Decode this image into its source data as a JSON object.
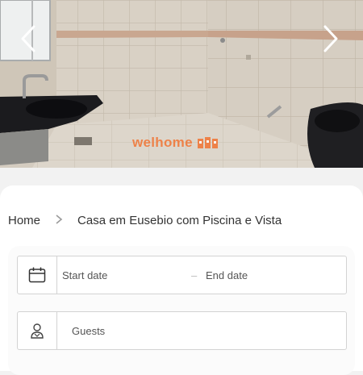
{
  "gallery": {
    "prev_icon": "chevron-left-icon",
    "next_icon": "chevron-right-icon",
    "watermark": "welhome"
  },
  "breadcrumb": {
    "home": "Home",
    "separator_icon": "chevron-right-icon",
    "current": "Casa em Eusebio com Piscina e Vista"
  },
  "booking": {
    "calendar_icon": "calendar-icon",
    "start_placeholder": "Start date",
    "dash": "–",
    "end_placeholder": "End date",
    "guests_icon": "person-icon",
    "guests_placeholder": "Guests"
  },
  "colors": {
    "brand_orange": "#f07a3c",
    "tile": "#d8d0c4",
    "border": "#d3d3d3"
  }
}
